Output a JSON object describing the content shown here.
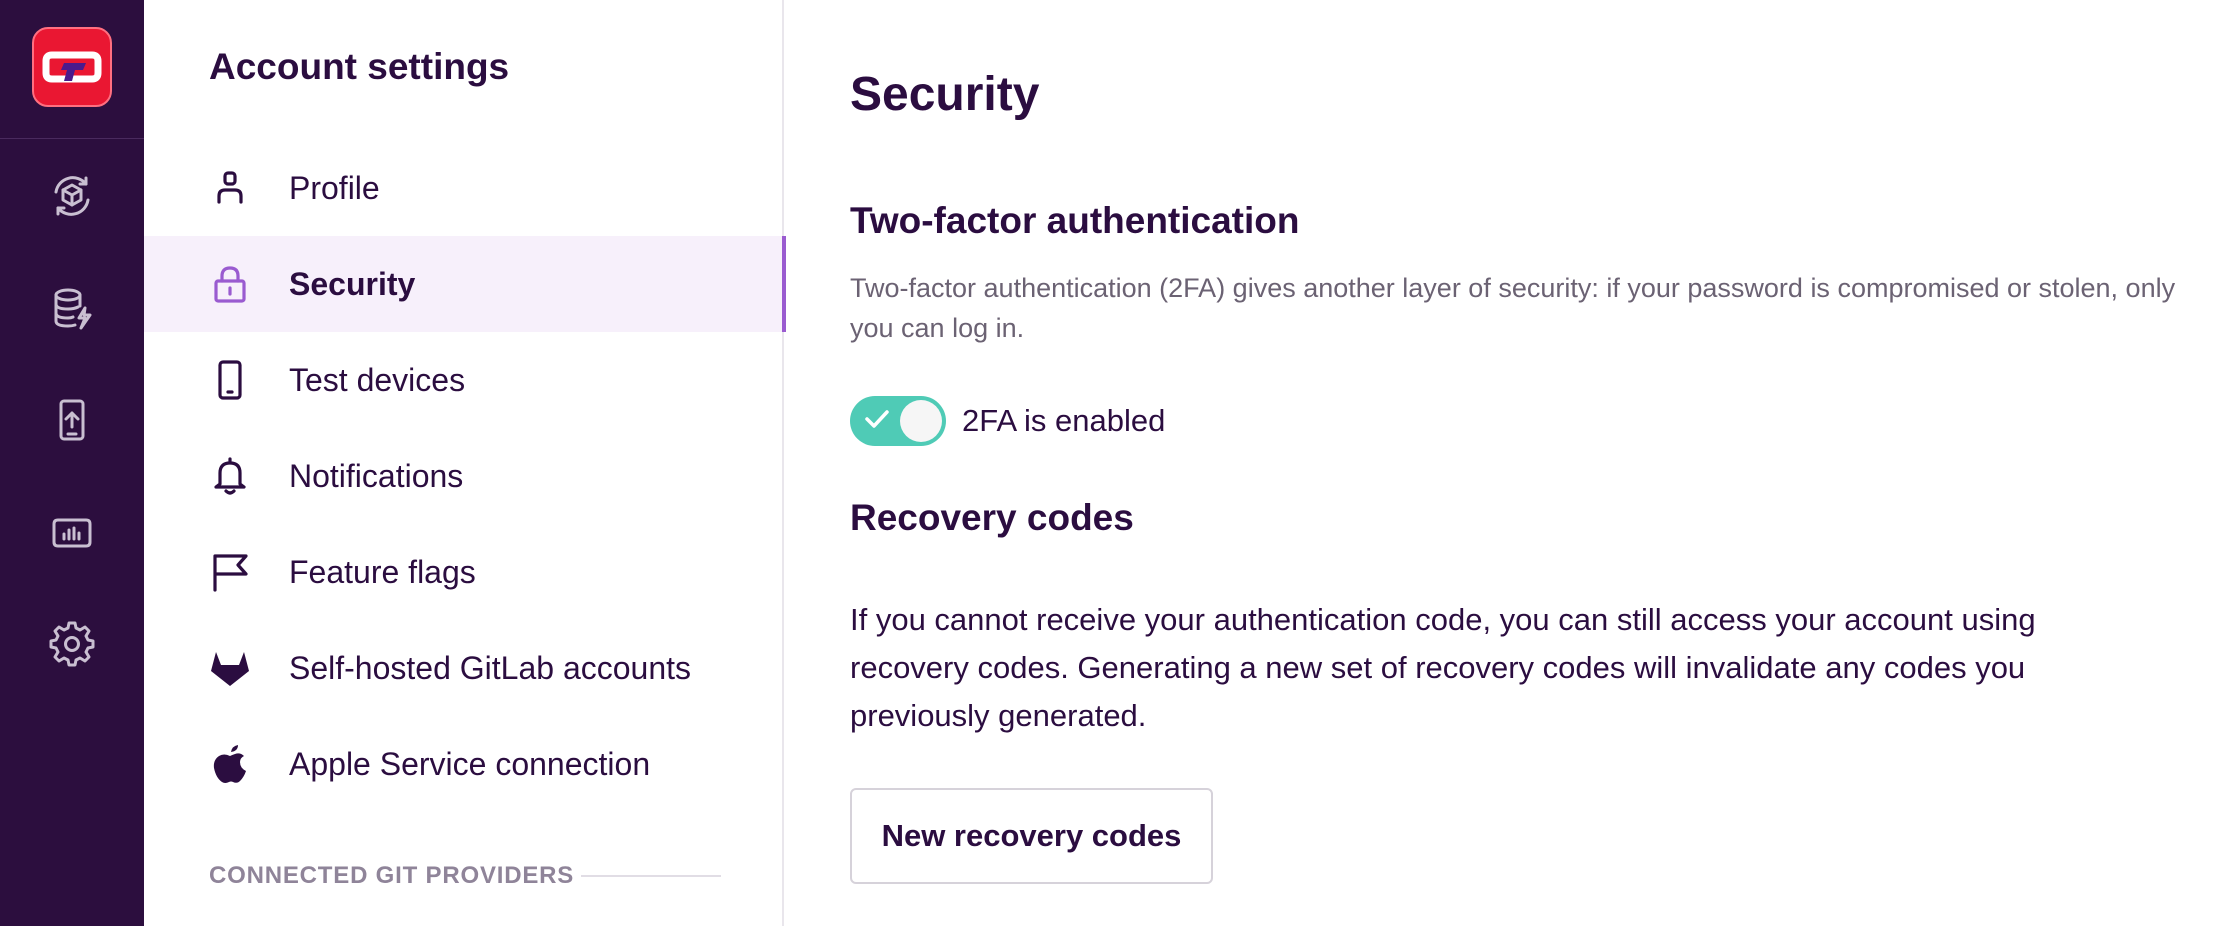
{
  "app": {
    "logo_icon": "codemagic-logo-icon",
    "rail_items": [
      {
        "icon": "builds-cube-icon"
      },
      {
        "icon": "database-lightning-icon"
      },
      {
        "icon": "phone-upload-icon"
      },
      {
        "icon": "dashboard-chart-icon"
      },
      {
        "icon": "gear-icon"
      }
    ]
  },
  "settings_nav": {
    "title": "Account settings",
    "items": [
      {
        "label": "Profile",
        "icon": "user-icon"
      },
      {
        "label": "Security",
        "icon": "lock-icon",
        "active": true
      },
      {
        "label": "Test devices",
        "icon": "phone-icon"
      },
      {
        "label": "Notifications",
        "icon": "bell-icon"
      },
      {
        "label": "Feature flags",
        "icon": "flag-icon"
      },
      {
        "label": "Self-hosted GitLab accounts",
        "icon": "gitlab-icon"
      },
      {
        "label": "Apple Service connection",
        "icon": "apple-icon"
      }
    ],
    "section_label": "CONNECTED GIT PROVIDERS"
  },
  "main": {
    "title": "Security",
    "twofa": {
      "heading": "Two-factor authentication",
      "description": "Two-factor authentication (2FA) gives another layer of security: if your password is compromised or stolen, only you can log in.",
      "toggle_on": true,
      "toggle_label": "2FA is enabled"
    },
    "recovery": {
      "heading": "Recovery codes",
      "description": "If you cannot receive your authentication code, you can still access your account using recovery codes. Generating a new set of recovery codes will invalidate any codes you previously generated.",
      "button_label": "New recovery codes"
    }
  },
  "colors": {
    "rail_bg": "#2c0e3e",
    "accent": "#9a5bd0",
    "active_bg": "#f7f0fb",
    "toggle_on": "#4fcbb6",
    "logo_red": "#ea1732",
    "text": "#2b0d40"
  }
}
